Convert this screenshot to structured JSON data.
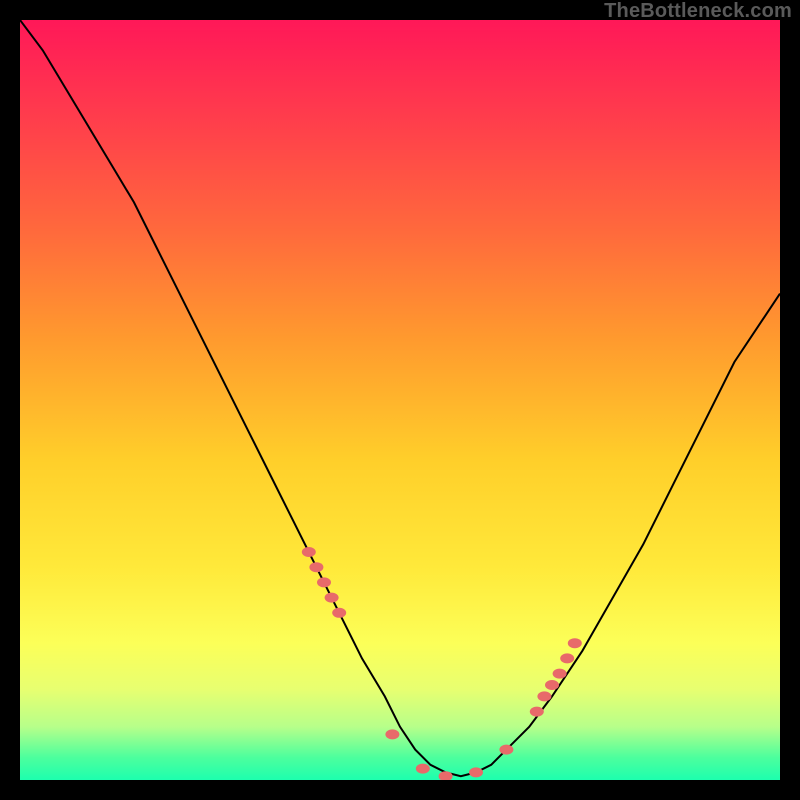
{
  "watermark": "TheBottleneck.com",
  "colors": {
    "curve": "#000000",
    "marker": "#e86a6a",
    "marker_stroke": "#c94e4e"
  },
  "chart_data": {
    "type": "line",
    "title": "",
    "xlabel": "",
    "ylabel": "",
    "xlim": [
      0,
      100
    ],
    "ylim": [
      0,
      100
    ],
    "grid": false,
    "legend": false,
    "x": [
      0,
      3,
      6,
      9,
      12,
      15,
      18,
      21,
      24,
      27,
      30,
      33,
      36,
      39,
      42,
      45,
      48,
      50,
      52,
      54,
      56,
      58,
      60,
      62,
      64,
      67,
      70,
      74,
      78,
      82,
      86,
      90,
      94,
      98,
      100
    ],
    "values": [
      100,
      96,
      91,
      86,
      81,
      76,
      70,
      64,
      58,
      52,
      46,
      40,
      34,
      28,
      22,
      16,
      11,
      7,
      4,
      2,
      1,
      0.5,
      1,
      2,
      4,
      7,
      11,
      17,
      24,
      31,
      39,
      47,
      55,
      61,
      64
    ],
    "markers_x": [
      38,
      39,
      40,
      41,
      42,
      49,
      53,
      56,
      60,
      64,
      68,
      69,
      70,
      71,
      72,
      73
    ],
    "markers_y": [
      30,
      28,
      26,
      24,
      22,
      6,
      1.5,
      0.5,
      1,
      4,
      9,
      11,
      12.5,
      14,
      16,
      18
    ]
  }
}
